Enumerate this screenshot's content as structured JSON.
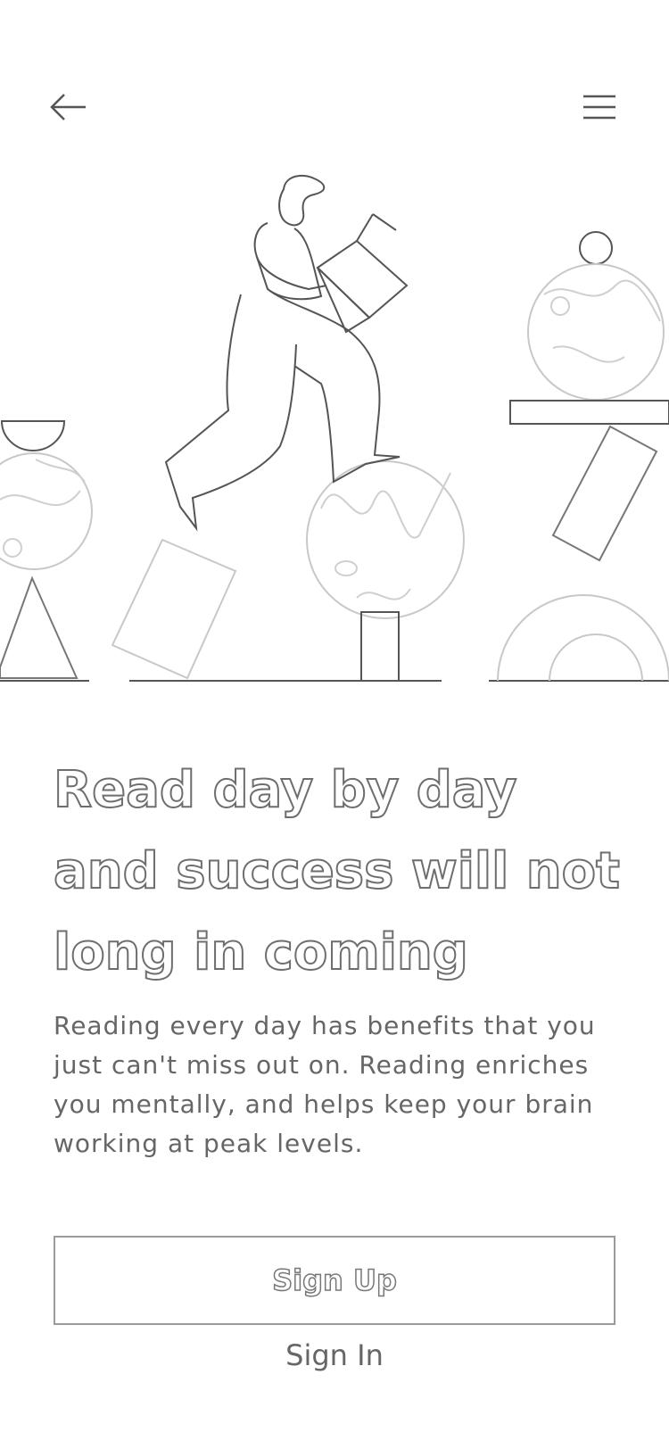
{
  "nav": {
    "back_icon": "arrow-left-icon",
    "menu_icon": "hamburger-menu-icon"
  },
  "hero": {
    "illustration": "person-balancing-shapes-illustration"
  },
  "content": {
    "headline": "Read day by day and success will not long in coming",
    "description": "Reading every day has benefits that you just can't miss out on. Reading enriches you mentally, and helps keep your brain working at peak levels."
  },
  "actions": {
    "signup_label": "Sign Up",
    "signin_label": "Sign In"
  },
  "colors": {
    "stroke": "#555555",
    "light_stroke": "#bdbdbd",
    "background": "#ffffff"
  }
}
